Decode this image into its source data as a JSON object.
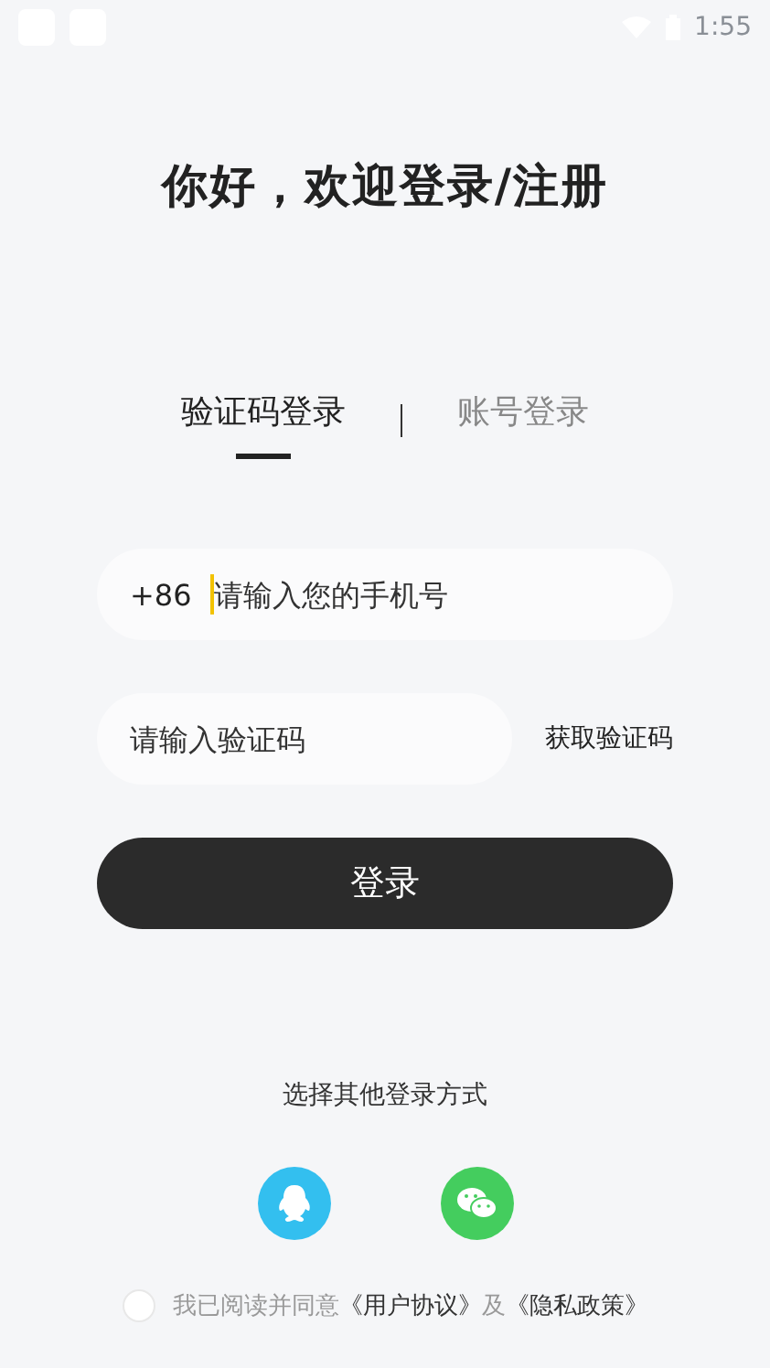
{
  "status_bar": {
    "time": "1:55"
  },
  "title": "你好，欢迎登录/注册",
  "tabs": [
    {
      "label": "验证码登录",
      "selected": true
    },
    {
      "label": "账号登录",
      "selected": false
    }
  ],
  "phone_field": {
    "prefix": "+86",
    "placeholder": "请输入您的手机号"
  },
  "code_field": {
    "placeholder": "请输入验证码"
  },
  "get_code_button": "获取验证码",
  "login_button": "登录",
  "other_login": {
    "label": "选择其他登录方式",
    "options": [
      {
        "kind": "qq",
        "color": "#33bfef"
      },
      {
        "kind": "wechat",
        "color": "#44cd5e"
      }
    ]
  },
  "agreement": {
    "checked": false,
    "text": "我已阅读并同意",
    "link_1": "《用户协议》",
    "conjunction": "及",
    "link_2": "《隐私政策》"
  }
}
